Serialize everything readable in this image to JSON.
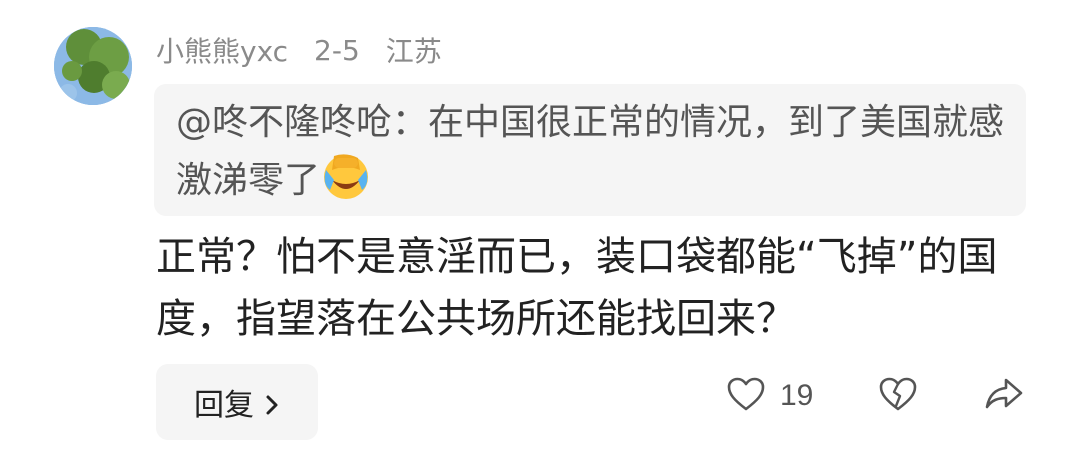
{
  "comment": {
    "username": "小熊熊yxc",
    "date": "2-5",
    "location": "江苏",
    "quote_text": "@咚不隆咚呛：在中国很正常的情况，到了美国就感激涕零了",
    "quote_emoji": "face-palm-laughing-emoji",
    "body": "正常？怕不是意淫而已，装口袋都能“飞掉”的国度，指望落在公共场所还能找回来？"
  },
  "actions": {
    "reply_label": "回复",
    "like_count": "19"
  },
  "icons": {
    "reply": "chevron-right-icon",
    "like": "heart-outline-icon",
    "dislike": "broken-heart-icon",
    "share": "share-arrow-icon"
  },
  "colors": {
    "meta_text": "#8a8a8a",
    "quote_background": "#f5f5f5",
    "body_text": "#222222"
  }
}
